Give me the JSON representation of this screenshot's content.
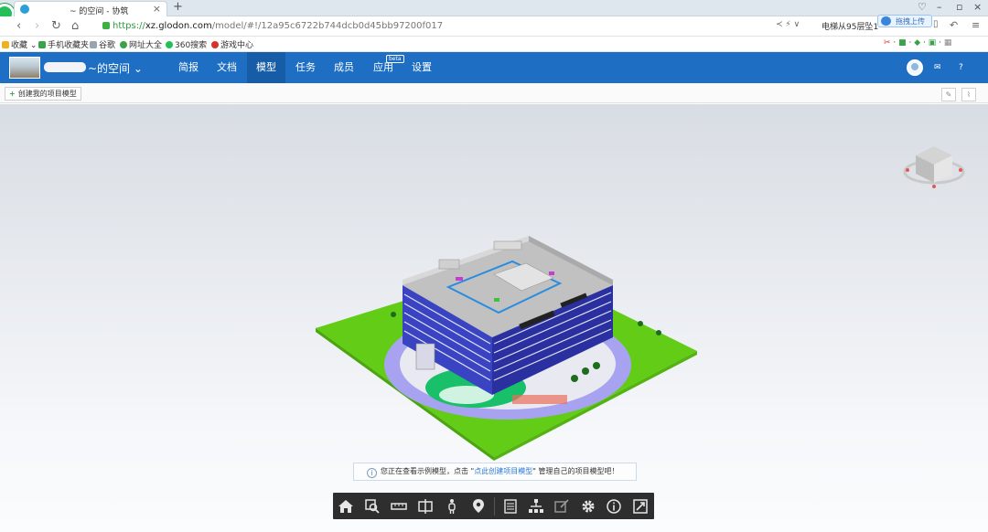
{
  "browser": {
    "tab_title": "~ 的空间 - 协筑",
    "url_proto": "https://",
    "url_host": "xz.glodon.com",
    "url_path": "/model/#!/12a95c6722b744dcb0d45bb97200f017",
    "hot_search": "电梯从95层坠1",
    "upload_label": "拖拽上传"
  },
  "bookmarks": [
    {
      "label": "收藏",
      "color": "#f2b01e"
    },
    {
      "label": "手机收藏夹",
      "color": "#3aa24a"
    },
    {
      "label": "谷歌",
      "color": "#9aa4ae"
    },
    {
      "label": "网址大全",
      "color": "#3aa24a"
    },
    {
      "label": "360搜索",
      "color": "#23c05a"
    },
    {
      "label": "游戏中心",
      "color": "#d8332a"
    }
  ],
  "app": {
    "space_name": "~的空间",
    "nav": [
      {
        "label": "简报"
      },
      {
        "label": "文档"
      },
      {
        "label": "模型"
      },
      {
        "label": "任务"
      },
      {
        "label": "成员"
      },
      {
        "label": "应用"
      },
      {
        "label": "设置"
      }
    ],
    "beta_badge": "beta",
    "active_nav": "模型"
  },
  "toolbar": {
    "create_label": "创建我的项目模型",
    "plus": "+"
  },
  "viewer": {
    "notice_prefix": "您正在查看示例模型，点击 \"",
    "notice_link": "点此创建项目模型",
    "notice_suffix": "\" 管理自己的项目模型吧！",
    "dock_icons": [
      "home-icon",
      "zoom-icon",
      "measure-icon",
      "section-icon",
      "walk-person-icon",
      "location-pin-icon",
      "list-icon",
      "tree-icon",
      "annotate-icon",
      "settings-gear-icon",
      "info-icon",
      "fullscreen-icon"
    ],
    "colors": {
      "ground": "#5fcb17",
      "accent": "#1e6fc4",
      "building_glass": "#2d35a8",
      "roof": "#bcbcbc"
    }
  }
}
